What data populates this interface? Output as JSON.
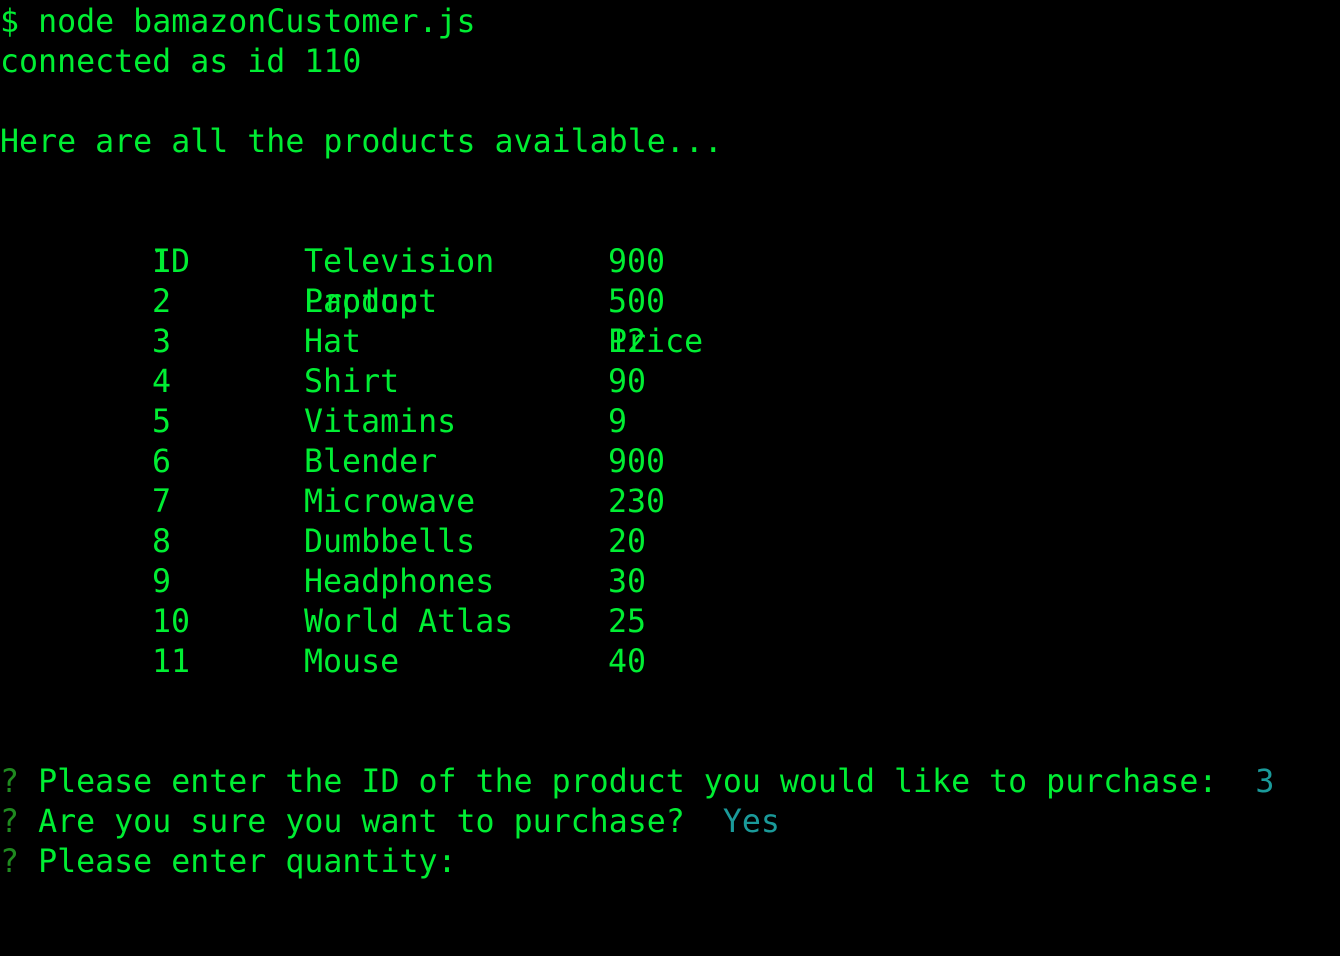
{
  "terminal": {
    "prompt_symbol": "$",
    "command": "node bamazonCustomer.js",
    "connection_line": "connected as id 110",
    "intro_line": "Here are all the products available...",
    "table": {
      "headers": {
        "id": "ID",
        "product": "Product",
        "price": "Price"
      },
      "rows": [
        {
          "id": "1",
          "product": "Television",
          "price": "900"
        },
        {
          "id": "2",
          "product": "Laptop",
          "price": "500"
        },
        {
          "id": "3",
          "product": "Hat",
          "price": "12"
        },
        {
          "id": "4",
          "product": "Shirt",
          "price": "90"
        },
        {
          "id": "5",
          "product": "Vitamins",
          "price": "9"
        },
        {
          "id": "6",
          "product": "Blender",
          "price": "900"
        },
        {
          "id": "7",
          "product": "Microwave",
          "price": "230"
        },
        {
          "id": "8",
          "product": "Dumbbells",
          "price": "20"
        },
        {
          "id": "9",
          "product": "Headphones",
          "price": "30"
        },
        {
          "id": "10",
          "product": "World Atlas",
          "price": "25"
        },
        {
          "id": "11",
          "product": "Mouse",
          "price": "40"
        }
      ]
    },
    "prompts": [
      {
        "marker": "?",
        "question": "Please enter the ID of the product you would like to purchase:",
        "answer": "3"
      },
      {
        "marker": "?",
        "question": "Are you sure you want to purchase?",
        "answer": "Yes"
      },
      {
        "marker": "?",
        "question": "Please enter quantity:",
        "answer": ""
      }
    ]
  },
  "colors": {
    "background": "#000000",
    "text": "#00ee33",
    "question_marker": "#1f8a1f",
    "answer": "#1a9a9a"
  }
}
